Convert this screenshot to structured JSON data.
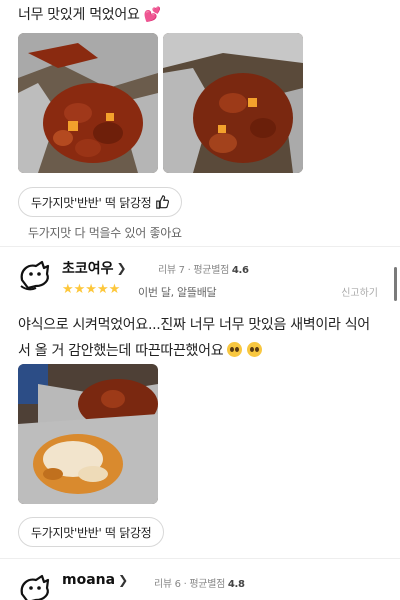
{
  "review1": {
    "text": "너무 맛있게 먹었어요",
    "heart": "💕",
    "menu_chip": "두가지맛'반반' 떡 닭강정",
    "menu_comment": "두가지맛 다 먹을수 있어 좋아요"
  },
  "review2": {
    "name": "초코여우",
    "review_count": "리뷰 7",
    "avg_label": "평균별점",
    "avg": "4.6",
    "stars": "★★★★★",
    "when": "이번 달, 알뜰배달",
    "report": "신고하기",
    "text_line1": "야식으로 시켜먹었어요...진짜 너무 너무 맛있음 새벽이라 식어",
    "text_line2": "서 올 거 감안했는데 따끈따끈했어요",
    "menu_chip": "두가지맛'반반' 떡 닭강정"
  },
  "review3": {
    "name": "moana",
    "review_count": "리뷰 6",
    "avg_label": "평균별점",
    "avg": "4.8"
  },
  "colors": {
    "star": "#fdc73b",
    "heart": "#e0549b",
    "sauce": "#8a2a10"
  }
}
